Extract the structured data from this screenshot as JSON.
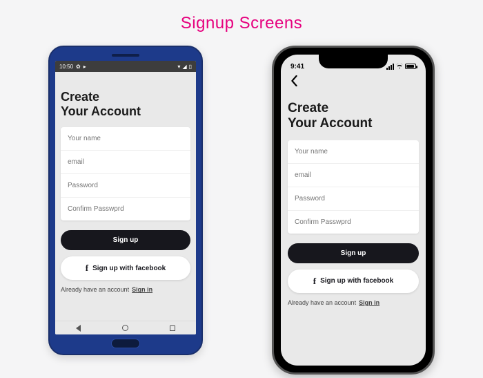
{
  "page_title": "Signup Screens",
  "colors": {
    "accent": "#e6007e",
    "button_dark": "#17171d"
  },
  "android": {
    "status": {
      "time": "10:50"
    },
    "heading_line1": "Create",
    "heading_line2": "Your Account",
    "fields": {
      "name_placeholder": "Your name",
      "email_placeholder": "email",
      "password_placeholder": "Password",
      "confirm_placeholder": "Confirm Passwprd"
    },
    "signup_label": "Sign up",
    "facebook_label": "Sign up with facebook",
    "already_text": "Already have an account",
    "signin_label": "Sign in"
  },
  "ios": {
    "status": {
      "time": "9:41"
    },
    "heading_line1": "Create",
    "heading_line2": "Your Account",
    "fields": {
      "name_placeholder": "Your name",
      "email_placeholder": "email",
      "password_placeholder": "Password",
      "confirm_placeholder": "Confirm Passwprd"
    },
    "signup_label": "Sign up",
    "facebook_label": "Sign up with facebook",
    "already_text": "Already have an account",
    "signin_label": "Sign in"
  }
}
